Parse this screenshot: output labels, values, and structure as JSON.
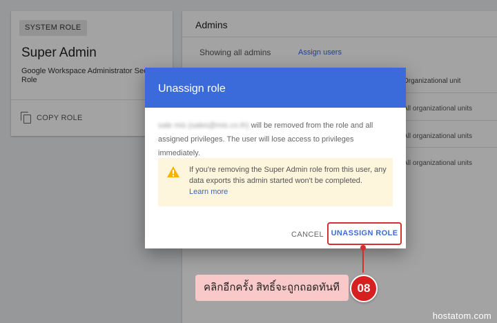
{
  "role_card": {
    "chip": "SYSTEM ROLE",
    "title": "Super Admin",
    "description_line1": "Google Workspace Administrator Seed",
    "description_line2": "Role",
    "copy_label": "COPY ROLE"
  },
  "admins": {
    "title": "Admins",
    "showing": "Showing all admins",
    "assign_link": "Assign users",
    "column_header": "Organizational unit",
    "rows": [
      "All organizational units",
      "All organizational units",
      "All organizational units"
    ]
  },
  "dialog": {
    "title": "Unassign role",
    "user_redacted": "sale mis (sales@mis.co.th)",
    "message": " will be removed from the role and all assigned privileges. The user will lose access to privileges immediately.",
    "warning_text": "If you're removing the Super Admin role from this user, any data exports this admin started won't be completed.",
    "learn_more": "Learn more",
    "cancel_label": "CANCEL",
    "confirm_label": "UNASSIGN ROLE"
  },
  "annotation": {
    "text": "คลิกอีกครั้ง สิทธิ์จะถูกถอดทันที",
    "step": "08"
  },
  "watermark": "hostatom.com",
  "colors": {
    "header": "#3b6bdb",
    "accent_red": "#d32f2f",
    "warning_bg": "#fdf5dc"
  }
}
